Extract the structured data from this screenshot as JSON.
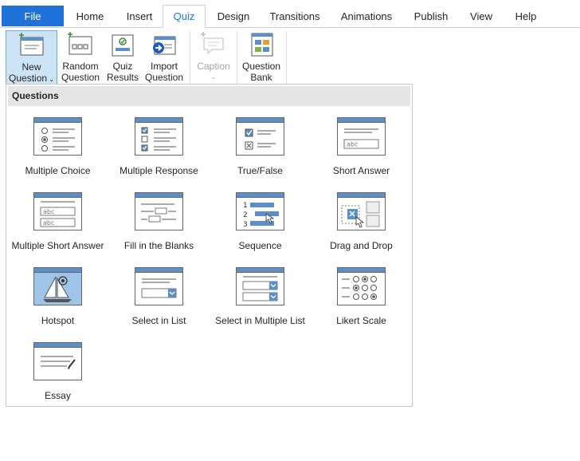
{
  "tabs": {
    "file": "File",
    "items": [
      "Home",
      "Insert",
      "Quiz",
      "Design",
      "Transitions",
      "Animations",
      "Publish",
      "View",
      "Help"
    ],
    "active": "Quiz"
  },
  "ribbon": {
    "new_question": [
      "New",
      "Question"
    ],
    "random_question": [
      "Random",
      "Question"
    ],
    "quiz_results": [
      "Quiz",
      "Results"
    ],
    "import_question": [
      "Import",
      "Question"
    ],
    "caption": "Caption",
    "question_bank": [
      "Question",
      "Bank"
    ]
  },
  "panel": {
    "header": "Questions",
    "items": [
      "Multiple Choice",
      "Multiple Response",
      "True/False",
      "Short Answer",
      "Multiple Short Answer",
      "Fill in the Blanks",
      "Sequence",
      "Drag and Drop",
      "Hotspot",
      "Select in List",
      "Select in Multiple List",
      "Likert Scale",
      "Essay"
    ],
    "icon_text": {
      "abc": "abc",
      "seq_1": "1",
      "seq_2": "2",
      "seq_3": "3"
    }
  },
  "colors": {
    "accent": "#1e72d9",
    "icon_header": "#5b8fc9",
    "selected_bg": "#cde4f7"
  }
}
